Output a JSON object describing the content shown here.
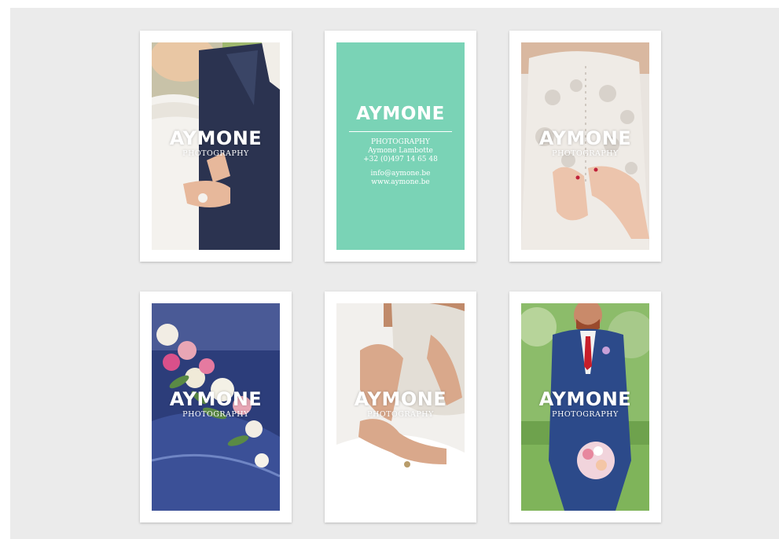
{
  "brand": {
    "name": "AYMONE",
    "tagline": "PHOTOGRAPHY"
  },
  "info_card": {
    "heading": "AYMONE",
    "lines": [
      "PHOTOGRAPHY",
      "Aymone Lambotte",
      "+32 (0)497 14 65 48"
    ],
    "contact": [
      "info@aymone.be",
      "www.aymone.be"
    ]
  },
  "colors": {
    "mint": "#7ad3b6",
    "background": "#ebebeb",
    "card": "#ffffff"
  },
  "cards": [
    {
      "subject": "bride-and-groom-arm-in-arm"
    },
    {
      "subject": "contact-info"
    },
    {
      "subject": "lace-dress-buttons"
    },
    {
      "subject": "bouquet-on-car-hood"
    },
    {
      "subject": "bride-hands-dress"
    },
    {
      "subject": "groom-with-bouquet"
    }
  ]
}
